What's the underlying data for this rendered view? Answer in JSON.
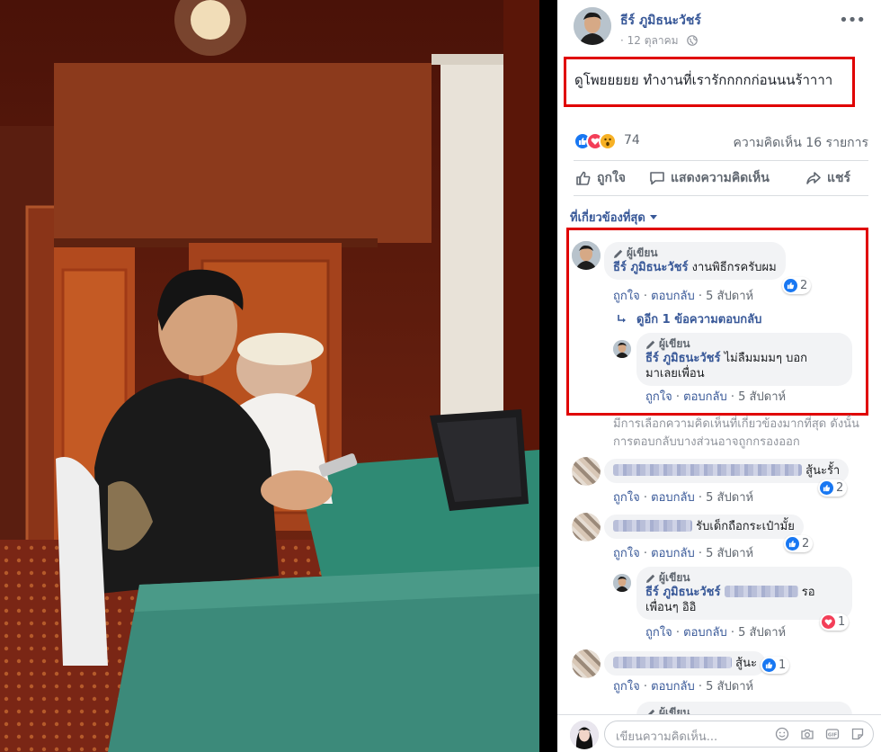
{
  "post": {
    "author": "ธีร์ ภูมิธนะวัชร์",
    "date": "12 ตุลาคม",
    "date_sep": "·",
    "text": "ดูโพยยยยย ทำงานที่เรารักกกกก่อนนนร้าาาา",
    "reaction_count": "74",
    "comment_count_label": "ความคิดเห็น 16 รายการ"
  },
  "actions": {
    "like": "ถูกใจ",
    "comment": "แสดงความคิดเห็น",
    "share": "แชร์"
  },
  "filter_label": "ที่เกี่ยวข้องที่สุด",
  "author_badge": "ผู้เขียน",
  "comment_actions": {
    "like": "ถูกใจ",
    "reply": "ตอบกลับ",
    "sep": "·",
    "time": "5 สัปดาห์"
  },
  "comments": [
    {
      "name": "ธีร์ ภูมิธนะวัชร์",
      "text": "งานพิธีกรครับผม",
      "reactions": "2"
    },
    {
      "text": "สู้นะรั้า",
      "reactions": "2"
    },
    {
      "text": "รับเด็กถือกระเป๋ามั้ย",
      "reactions": "2"
    },
    {
      "text": "สู้นะ",
      "reactions": "1"
    }
  ],
  "replies": [
    {
      "name": "ธีร์ ภูมิธนะวัชร์",
      "text_line1": "ไม่ลืมมมมๆ บอก",
      "text_line2": "มาเลยเพื่อน"
    },
    {
      "name": "ธีร์ ภูมิธนะวัชร์",
      "text_a": "รอ",
      "text_line2": "เพื่อนๆ อิอิ",
      "reactions": "1"
    }
  ],
  "view_replies": "ดูอีก 1 ข้อความตอบกลับ",
  "notice": "มีการเลือกความคิดเห็นที่เกี่ยวข้องมากที่สุด ดังนั้นการตอบกลับบางส่วนอาจถูกกรองออก",
  "composer_placeholder": "เขียนความคิดเห็น...",
  "colors": {
    "link": "#385898",
    "highlight_border": "#e00000",
    "like_blue": "#1877f2",
    "love_red": "#f33e58"
  },
  "icons": [
    "globe-icon",
    "more-dots-icon",
    "like-icon",
    "comment-icon",
    "share-icon",
    "pencil-icon",
    "reply-arrow-icon",
    "emoji-icon",
    "camera-icon",
    "gif-icon",
    "sticker-icon"
  ]
}
